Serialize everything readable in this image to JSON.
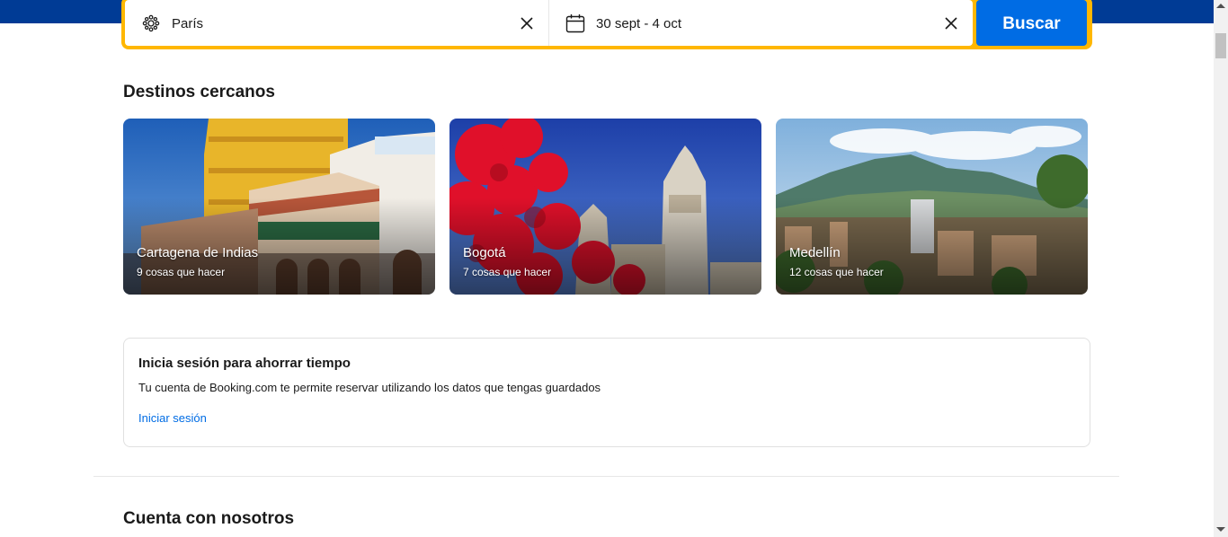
{
  "search": {
    "destination_value": "París",
    "destination_icon": "attraction-icon",
    "dates_value": "30 sept - 4 oct",
    "dates_icon": "calendar-icon",
    "clear_icon": "close-icon",
    "search_label": "Buscar"
  },
  "nearby": {
    "title": "Destinos cercanos",
    "destinations": [
      {
        "name": "Cartagena de Indias",
        "count": "9 cosas que hacer"
      },
      {
        "name": "Bogotá",
        "count": "7 cosas que hacer"
      },
      {
        "name": "Medellín",
        "count": "12 cosas que hacer"
      }
    ]
  },
  "signin": {
    "title": "Inicia sesión para ahorrar tiempo",
    "description": "Tu cuenta de Booking.com te permite reservar utilizando los datos que tengas guardados",
    "link": "Iniciar sesión"
  },
  "trust": {
    "title": "Cuenta con nosotros"
  },
  "colors": {
    "brand_blue": "#003b95",
    "accent_yellow": "#ffb700",
    "action_blue": "#006ce4"
  }
}
